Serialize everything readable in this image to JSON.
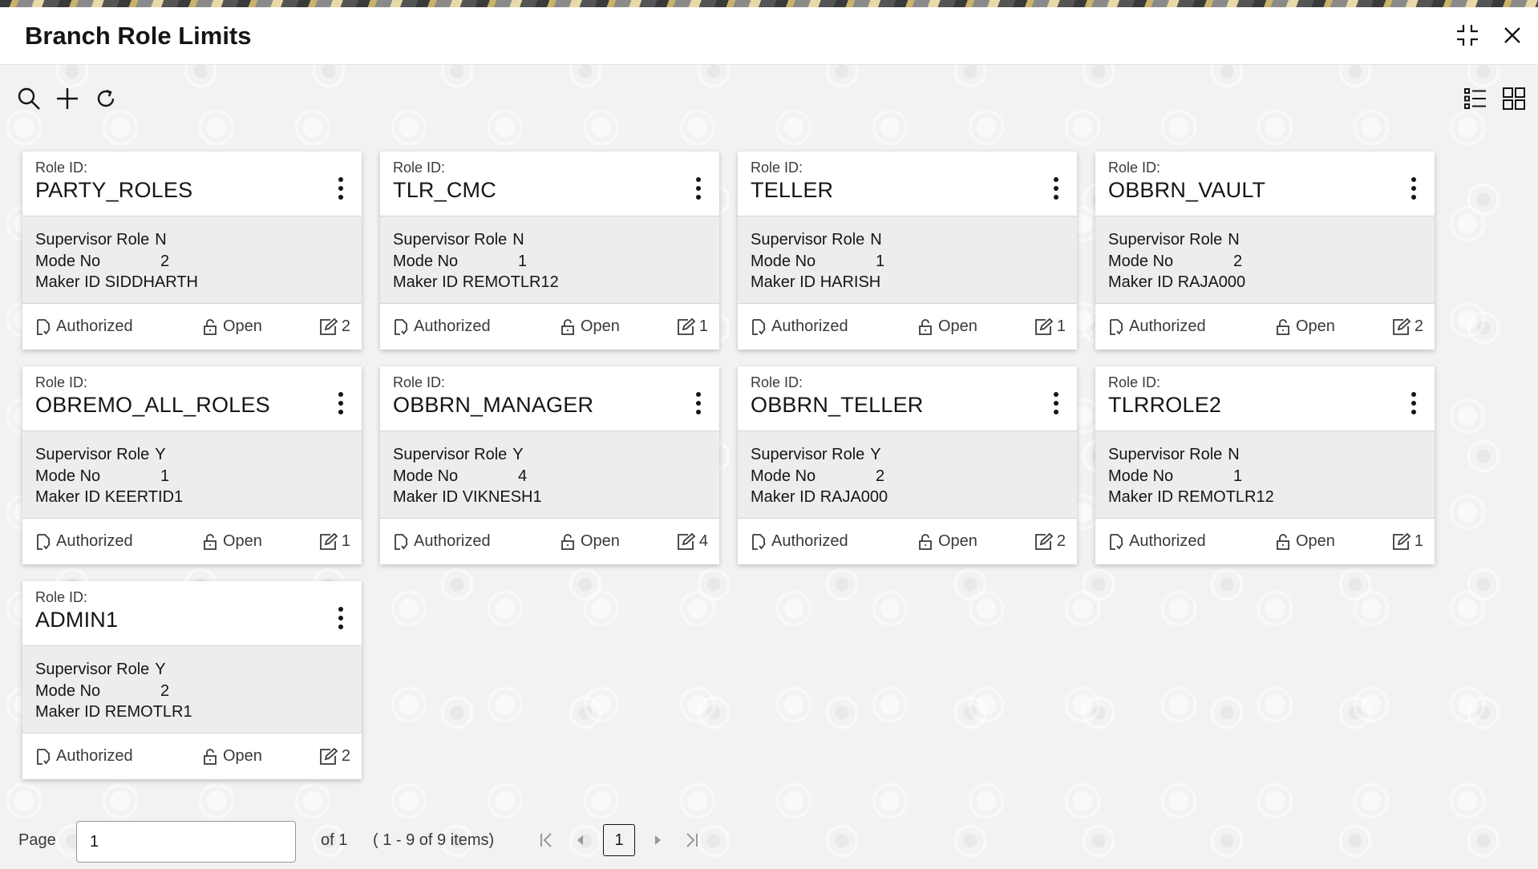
{
  "window": {
    "title": "Branch Role Limits"
  },
  "card_labels": {
    "role_id": "Role ID:",
    "supervisor_role": "Supervisor Role",
    "mode_no": "Mode No",
    "maker_id": "Maker ID",
    "authorized": "Authorized",
    "open": "Open"
  },
  "cards": [
    {
      "role_id": "PARTY_ROLES",
      "supervisor_role": "N",
      "mode_no": "2",
      "maker_id": "SIDDHARTH",
      "status": "Authorized",
      "record": "Open",
      "mod_count": "2"
    },
    {
      "role_id": "TLR_CMC",
      "supervisor_role": "N",
      "mode_no": "1",
      "maker_id": "REMOTLR12",
      "status": "Authorized",
      "record": "Open",
      "mod_count": "1"
    },
    {
      "role_id": "TELLER",
      "supervisor_role": "N",
      "mode_no": "1",
      "maker_id": "HARISH",
      "status": "Authorized",
      "record": "Open",
      "mod_count": "1"
    },
    {
      "role_id": "OBBRN_VAULT",
      "supervisor_role": "N",
      "mode_no": "2",
      "maker_id": "RAJA000",
      "status": "Authorized",
      "record": "Open",
      "mod_count": "2"
    },
    {
      "role_id": "OBREMO_ALL_ROLES",
      "supervisor_role": "Y",
      "mode_no": "1",
      "maker_id": "KEERTID1",
      "status": "Authorized",
      "record": "Open",
      "mod_count": "1"
    },
    {
      "role_id": "OBBRN_MANAGER",
      "supervisor_role": "Y",
      "mode_no": "4",
      "maker_id": "VIKNESH1",
      "status": "Authorized",
      "record": "Open",
      "mod_count": "4"
    },
    {
      "role_id": "OBBRN_TELLER",
      "supervisor_role": "Y",
      "mode_no": "2",
      "maker_id": "RAJA000",
      "status": "Authorized",
      "record": "Open",
      "mod_count": "2"
    },
    {
      "role_id": "TLRROLE2",
      "supervisor_role": "N",
      "mode_no": "1",
      "maker_id": "REMOTLR12",
      "status": "Authorized",
      "record": "Open",
      "mod_count": "1"
    },
    {
      "role_id": "ADMIN1",
      "supervisor_role": "Y",
      "mode_no": "2",
      "maker_id": "REMOTLR1",
      "status": "Authorized",
      "record": "Open",
      "mod_count": "2"
    }
  ],
  "pager": {
    "label": "Page",
    "page_value": "1",
    "of_text": "of 1",
    "range_text": "( 1 - 9 of 9 items)",
    "current_page": "1"
  },
  "icons": {
    "toolbar": [
      "search-icon",
      "add-icon",
      "refresh-icon"
    ],
    "view": [
      "list-view-icon",
      "grid-view-icon"
    ],
    "window": [
      "minimize-icon",
      "close-icon"
    ]
  },
  "colors": {
    "accent": "#161513",
    "card_body": "#ededec",
    "background": "#f3f2f1"
  }
}
